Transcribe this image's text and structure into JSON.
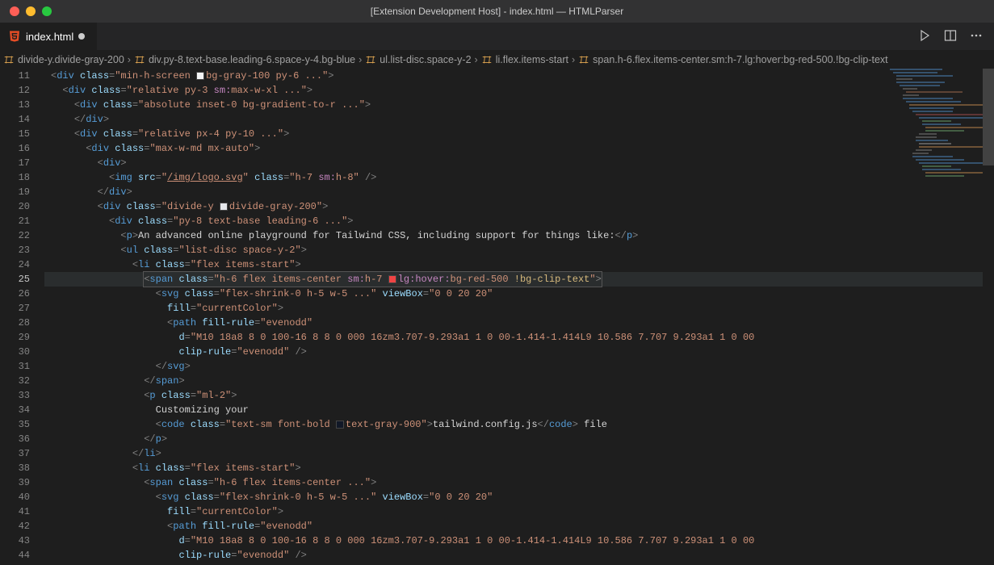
{
  "window": {
    "title": "[Extension Development Host] - index.html — HTMLParser"
  },
  "tab": {
    "filename": "index.html",
    "modified": true
  },
  "breadcrumb": {
    "items": [
      "divide-y.divide-gray-200",
      "div.py-8.text-base.leading-6.space-y-4.bg-blue",
      "ul.list-disc.space-y-2",
      "li.flex.items-start",
      "span.h-6.flex.items-center.sm:h-7.lg:hover:bg-red-500.!bg-clip-text"
    ]
  },
  "gutter": {
    "start": 11,
    "end": 44,
    "active": 25
  },
  "code": {
    "l11": {
      "tag": "div",
      "cls": "min-h-screen ",
      "swatch_cls": "bg-gray-100",
      "rest": " py-6 ..."
    },
    "l12": {
      "tag": "div",
      "cls": "relative py-3 ",
      "variantA": "sm:",
      "variantB": "max-w-xl",
      "rest": " ..."
    },
    "l13": {
      "tag": "div",
      "cls": "absolute inset-0 bg-gradient-to-r ..."
    },
    "l14": {
      "close": "div"
    },
    "l15": {
      "tag": "div",
      "cls": "relative px-4 py-10 ..."
    },
    "l16": {
      "tag": "div",
      "cls": "max-w-md mx-auto"
    },
    "l17": {
      "tag": "div"
    },
    "l18": {
      "tag": "img",
      "src": "/img/logo.svg",
      "cls_a": "h-7 ",
      "varA": "sm:",
      "varB": "h-8"
    },
    "l19": {
      "close": "div"
    },
    "l20": {
      "tag": "div",
      "cls_a": "divide-y ",
      "swatch_cls": "divide-gray-200"
    },
    "l21": {
      "tag": "div",
      "cls": "py-8 text-base leading-6 ..."
    },
    "l22": {
      "tag": "p",
      "text": "An advanced online playground for Tailwind CSS, including support for things like:"
    },
    "l23": {
      "tag": "ul",
      "cls": "list-disc space-y-2"
    },
    "l24": {
      "tag": "li",
      "cls": "flex items-start"
    },
    "l25": {
      "tag": "span",
      "cls_a": "h-6 flex items-center ",
      "varA": "sm:",
      "varB": "h-7",
      "swatch_variant": "lg:hover:",
      "swatch_cls": "bg-red-500",
      "bang": " !bg-clip-text"
    },
    "l26": {
      "tag": "svg",
      "cls": "flex-shrink-0 h-5 w-5 ...",
      "attr": "viewBox",
      "val": "0 0 20 20"
    },
    "l27": {
      "attr": "fill",
      "val": "currentColor"
    },
    "l28": {
      "tag": "path",
      "attr": "fill-rule",
      "val": "evenodd"
    },
    "l29": {
      "attr": "d",
      "val": "M10 18a8 8 0 100-16 8 8 0 000 16zm3.707-9.293a1 1 0 00-1.414-1.414L9 10.586 7.707 9.293a1 1 0 00"
    },
    "l30": {
      "attr": "clip-rule",
      "val": "evenodd"
    },
    "l31": {
      "close": "svg"
    },
    "l32": {
      "close": "span"
    },
    "l33": {
      "tag": "p",
      "cls": "ml-2"
    },
    "l34": {
      "text": "Customizing your"
    },
    "l35": {
      "tag": "code",
      "cls_a": "text-sm font-bold ",
      "swatch_cls": "text-gray-900",
      "text": "tailwind.config.js",
      "tail": " file"
    },
    "l36": {
      "close": "p"
    },
    "l37": {
      "close": "li"
    },
    "l38": {
      "tag": "li",
      "cls": "flex items-start"
    },
    "l39": {
      "tag": "span",
      "cls": "h-6 flex items-center ..."
    },
    "l40": {
      "tag": "svg",
      "cls": "flex-shrink-0 h-5 w-5 ...",
      "attr": "viewBox",
      "val": "0 0 20 20"
    },
    "l41": {
      "attr": "fill",
      "val": "currentColor"
    },
    "l42": {
      "tag": "path",
      "attr": "fill-rule",
      "val": "evenodd"
    },
    "l43": {
      "attr": "d",
      "val": "M10 18a8 8 0 100-16 8 8 0 000 16zm3.707-9.293a1 1 0 00-1.414-1.414L9 10.586 7.707 9.293a1 1 0 00"
    },
    "l44": {
      "attr": "clip-rule",
      "val": "evenodd"
    }
  }
}
